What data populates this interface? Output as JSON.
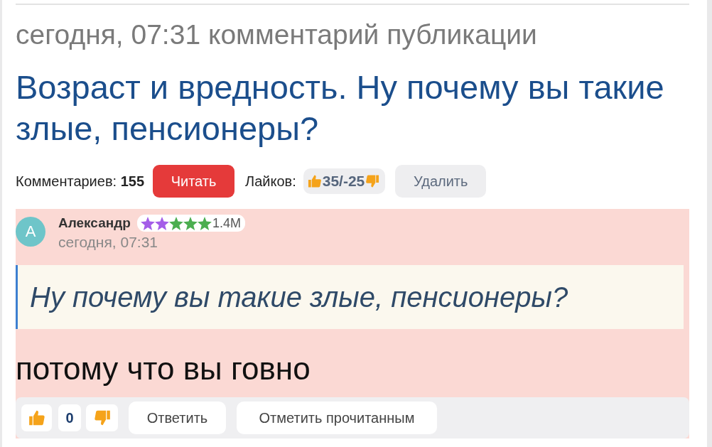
{
  "header": {
    "meta": "сегодня, 07:31 комментарий публикации",
    "title": "Возраст и вредность. Ну почему вы такие злые, пенсионеры?"
  },
  "stats": {
    "comments_label": "Комментариев:",
    "comments_count": "155",
    "read_button": "Читать",
    "likes_label": "Лайков:",
    "likes_value": "35/-25",
    "delete_button": "Удалить"
  },
  "comment": {
    "unread": true,
    "avatar_letter": "А",
    "author": "Александр",
    "badge": {
      "star_marks": [
        {
          "color": "#a45de8"
        },
        {
          "color": "#a45de8"
        },
        {
          "color": "#4cae50"
        },
        {
          "color": "#4cae50"
        },
        {
          "color": "#4cae50"
        }
      ],
      "score": "1.4M"
    },
    "time": "сегодня, 07:31",
    "quote": "Ну почему вы такие злые, пенсионеры?",
    "text": "потому что вы говно",
    "votes": "0",
    "actions": [
      "Ответить",
      "Отметить прочитанным"
    ]
  }
}
